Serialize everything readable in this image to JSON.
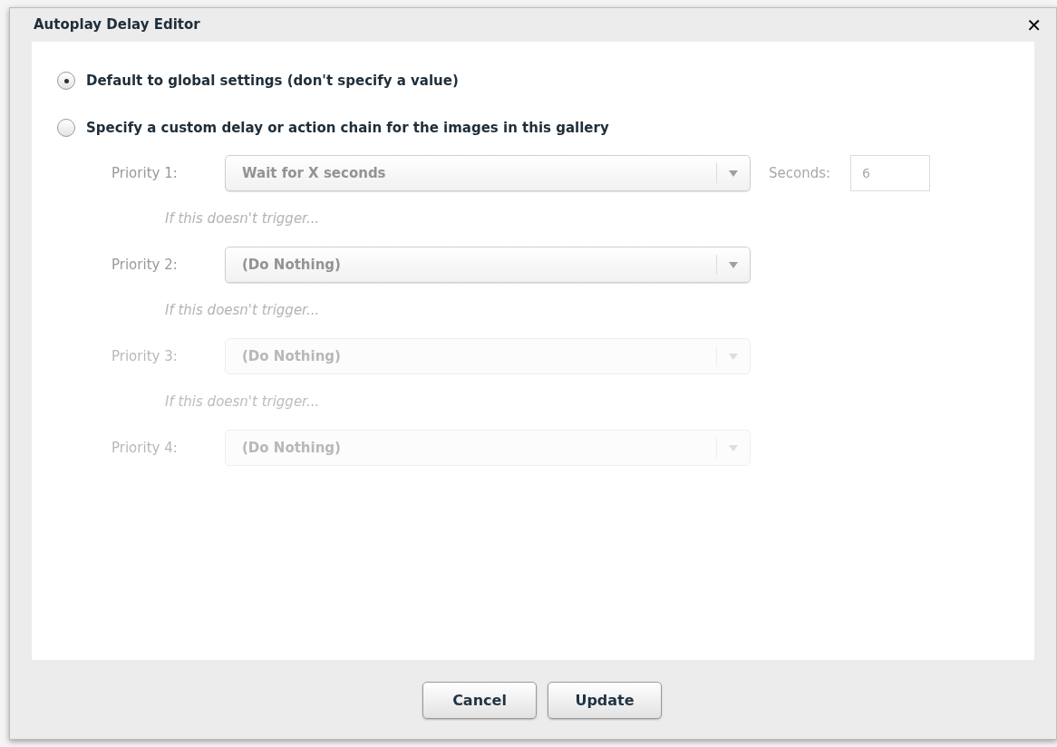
{
  "dialog": {
    "title": "Autoplay Delay Editor",
    "close": "✕"
  },
  "options": [
    {
      "label": "Default to global settings (don't specify a value)",
      "selected": true
    },
    {
      "label": "Specify a custom delay or action chain for the images in this gallery",
      "selected": false
    }
  ],
  "priorities": [
    {
      "label": "Priority 1:",
      "value": "Wait for X seconds",
      "disabled": false,
      "seconds": {
        "label": "Seconds:",
        "value": "6"
      },
      "hint": "If this doesn't trigger..."
    },
    {
      "label": "Priority 2:",
      "value": "(Do Nothing)",
      "disabled": false,
      "hint": "If this doesn't trigger..."
    },
    {
      "label": "Priority 3:",
      "value": "(Do Nothing)",
      "disabled": true,
      "hint": "If this doesn't trigger..."
    },
    {
      "label": "Priority 4:",
      "value": "(Do Nothing)",
      "disabled": true
    }
  ],
  "buttons": [
    "Cancel",
    "Update"
  ]
}
